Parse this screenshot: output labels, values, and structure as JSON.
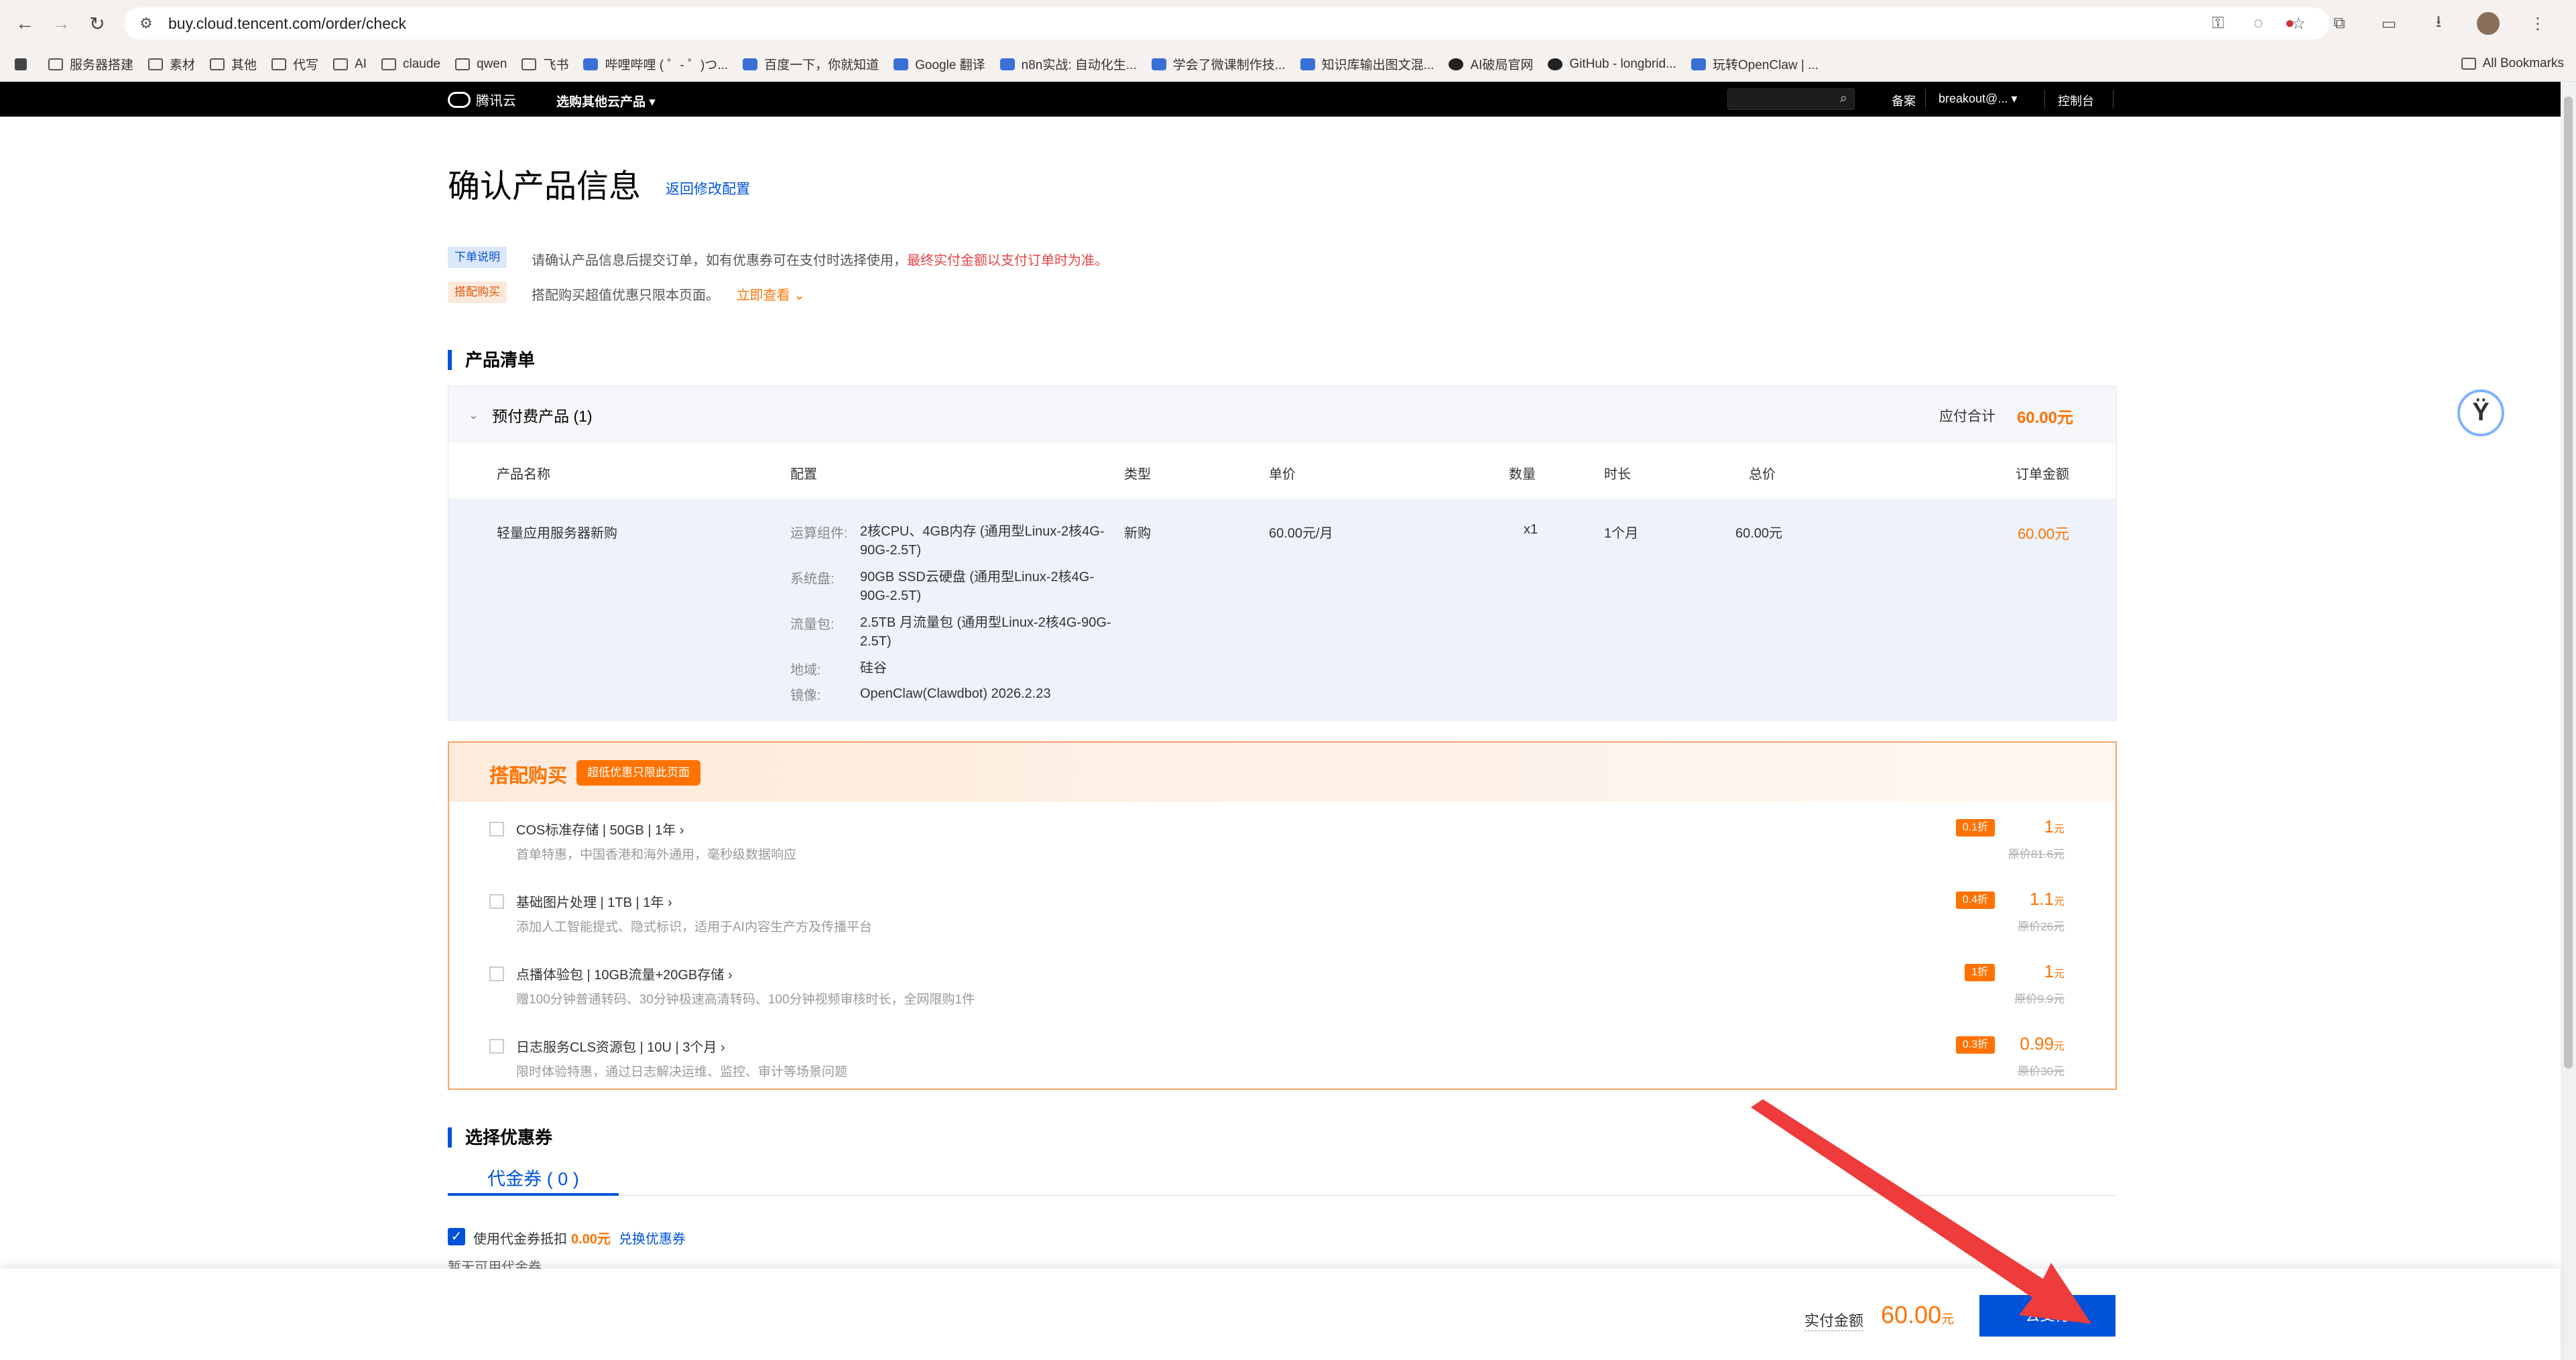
{
  "browser": {
    "url": "buy.cloud.tencent.com/order/check",
    "bookmarks": [
      "服务器搭建",
      "素材",
      "其他",
      "代写",
      "AI",
      "claude",
      "qwen",
      "飞书",
      "哔哩哔哩 ( ゜- ゜)つ...",
      "百度一下，你就知道",
      "Google 翻译",
      "n8n实战: 自动化生...",
      "学会了微课制作技...",
      "知识库输出图文混...",
      "AI破局官网",
      "GitHub - longbrid...",
      "玩转OpenClaw | ..."
    ],
    "all_bookmarks": "All Bookmarks"
  },
  "topnav": {
    "logo": "腾讯云",
    "product_menu": "选购其他云产品",
    "filing": "备案",
    "account": "breakout@...",
    "console": "控制台"
  },
  "page": {
    "title": "确认产品信息",
    "back_link": "返回修改配置",
    "tag_order": "下单说明",
    "note_order_a": "请确认产品信息后提交订单，如有优惠券可在支付时选择使用，",
    "note_order_b": "最终实付金额以支付订单时为准。",
    "tag_combo": "搭配购买",
    "note_combo": "搭配购买超值优惠只限本页面。",
    "note_combo_link": "立即查看"
  },
  "product_list": {
    "section_title": "产品清单",
    "group_title": "预付费产品 (1)",
    "total_label": "应付合计",
    "total_value": "60.00元",
    "columns": [
      "产品名称",
      "配置",
      "类型",
      "单价",
      "数量",
      "时长",
      "总价",
      "订单金额"
    ],
    "row": {
      "name": "轻量应用服务器新购",
      "config": [
        {
          "key": "运算组件:",
          "value": "2核CPU、4GB内存 (通用型Linux-2核4G-90G-2.5T)"
        },
        {
          "key": "系统盘:",
          "value": "90GB SSD云硬盘 (通用型Linux-2核4G-90G-2.5T)"
        },
        {
          "key": "流量包:",
          "value": "2.5TB 月流量包 (通用型Linux-2核4G-90G-2.5T)"
        },
        {
          "key": "地域:",
          "value": "硅谷"
        },
        {
          "key": "镜像:",
          "value": "OpenClaw(Clawdbot) 2026.2.23"
        }
      ],
      "type": "新购",
      "unit_price": "60.00元/月",
      "qty": "x1",
      "duration": "1个月",
      "total": "60.00元",
      "order_amount": "60.00元"
    }
  },
  "addon": {
    "title": "搭配购买",
    "pill": "超低优惠只限此页面",
    "items": [
      {
        "name": "COS标准存储 | 50GB | 1年",
        "desc": "首单特惠，中国香港和海外通用，毫秒级数据响应",
        "discount": "0.1折",
        "price": "1",
        "unit": "元",
        "orig": "原价81.6元"
      },
      {
        "name": "基础图片处理 | 1TB | 1年",
        "desc": "添加人工智能提式、隐式标识，适用于AI内容生产方及传播平台",
        "discount": "0.4折",
        "price": "1.1",
        "unit": "元",
        "orig": "原价26元"
      },
      {
        "name": "点播体验包 | 10GB流量+20GB存储",
        "desc": "赠100分钟普通转码、30分钟极速高清转码、100分钟视频审核时长，全网限购1件",
        "discount": "1折",
        "price": "1",
        "unit": "元",
        "orig": "原价9.9元"
      },
      {
        "name": "日志服务CLS资源包 | 10U | 3个月",
        "desc": "限时体验特惠，通过日志解决运维、监控、审计等场景问题",
        "discount": "0.3折",
        "price": "0.99",
        "unit": "元",
        "orig": "原价30元"
      }
    ]
  },
  "coupon": {
    "section_title": "选择优惠券",
    "tab": "代金券 ( 0 )",
    "use_label": "使用代金券抵扣",
    "use_amount": "0.00元",
    "exchange_link": "兑换优惠券",
    "none_text": "暂无可用代金券"
  },
  "footer": {
    "paid_label": "实付金额",
    "paid_value": "60.00",
    "paid_unit": "元",
    "pay_button": "去支付"
  },
  "colors": {
    "accent": "#0052d9",
    "price": "#ff7200",
    "annotation_arrow": "#ee3b3b"
  }
}
